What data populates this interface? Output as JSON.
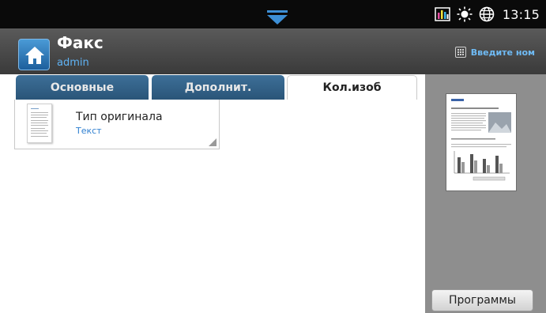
{
  "status_bar": {
    "clock": "13:15",
    "icons": [
      "pull-down-handle-icon",
      "toner-level-icon",
      "brightness-icon",
      "globe-icon"
    ]
  },
  "header": {
    "title": "Факс",
    "user": "admin",
    "enter_number_label": "Введите ном",
    "icons": [
      "home-icon",
      "keypad-icon"
    ]
  },
  "tabs": [
    {
      "label": "Основные",
      "active": false
    },
    {
      "label": "Дополнит.",
      "active": false
    },
    {
      "label": "Кол.изоб",
      "active": true
    }
  ],
  "options": [
    {
      "label": "Тип оригинала",
      "value": "Текст",
      "icon": "document-icon"
    }
  ],
  "preview": {
    "programs_label": "Программы"
  },
  "colors": {
    "accent_blue": "#2f7fd0",
    "tab_blue": "#2a5578",
    "header_gray": "#4a4a4a",
    "preview_gray": "#8e8e8e"
  }
}
